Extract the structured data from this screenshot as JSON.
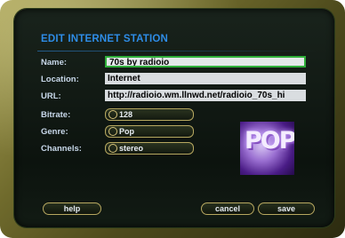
{
  "dialog": {
    "title": "EDIT INTERNET STATION"
  },
  "fields": {
    "name": {
      "label": "Name:",
      "value": "70s by radioio"
    },
    "location": {
      "label": "Location:",
      "value": "Internet"
    },
    "url": {
      "label": "URL:",
      "value": "http://radioio.wm.llnwd.net/radioio_70s_hi"
    }
  },
  "options": {
    "bitrate": {
      "label": "Bitrate:",
      "value": "128"
    },
    "genre": {
      "label": "Genre:",
      "value": "Pop"
    },
    "channels": {
      "label": "Channels:",
      "value": "stereo"
    }
  },
  "artwork": {
    "text": "POP"
  },
  "buttons": {
    "help": "help",
    "cancel": "cancel",
    "save": "save"
  },
  "colors": {
    "title": "#2e8ce6",
    "active_field_border": "#2fae3a",
    "button_border": "#b7a860"
  }
}
